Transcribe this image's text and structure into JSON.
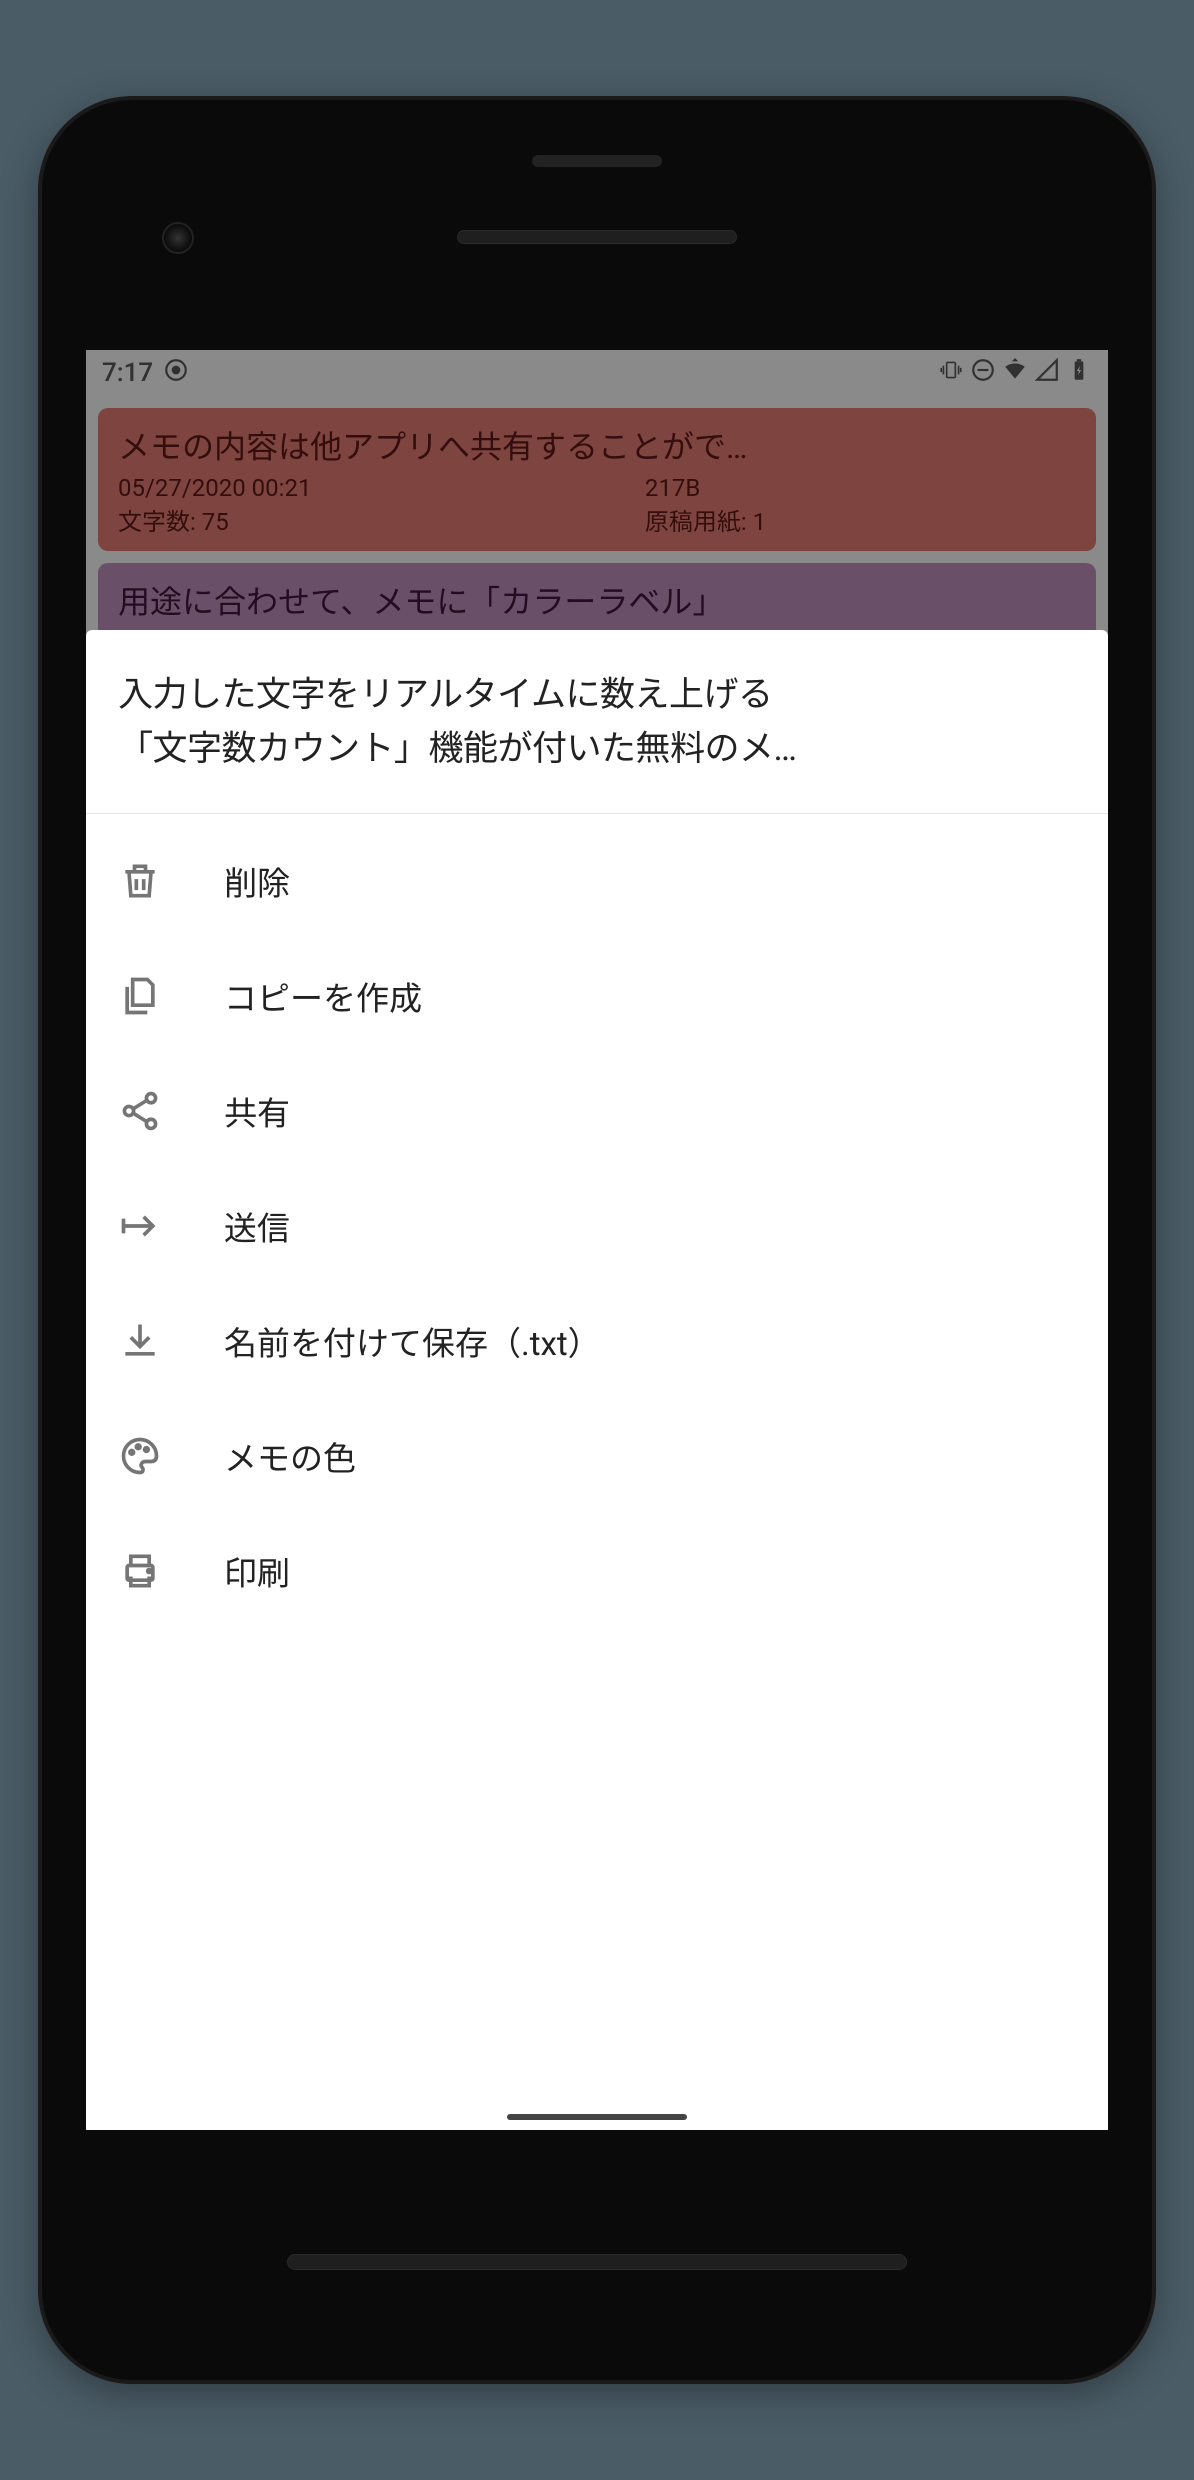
{
  "status": {
    "time": "7:17"
  },
  "memos": [
    {
      "title": "メモの内容は他アプリへ共有することがで…",
      "date": "05/27/2020 00:21",
      "size": "217B",
      "char_label": "文字数: 75",
      "paper_label": "原稿用紙: 1"
    },
    {
      "title": "用途に合わせて、メモに「カラーラベル」"
    }
  ],
  "sheet": {
    "title_line1": "入力した文字をリアルタイムに数え上げる",
    "title_line2": "「文字数カウント」機能が付いた無料のメ…"
  },
  "menu": {
    "delete": "削除",
    "copy": "コピーを作成",
    "share": "共有",
    "send": "送信",
    "save_as": "名前を付けて保存（.txt）",
    "color": "メモの色",
    "print": "印刷"
  }
}
